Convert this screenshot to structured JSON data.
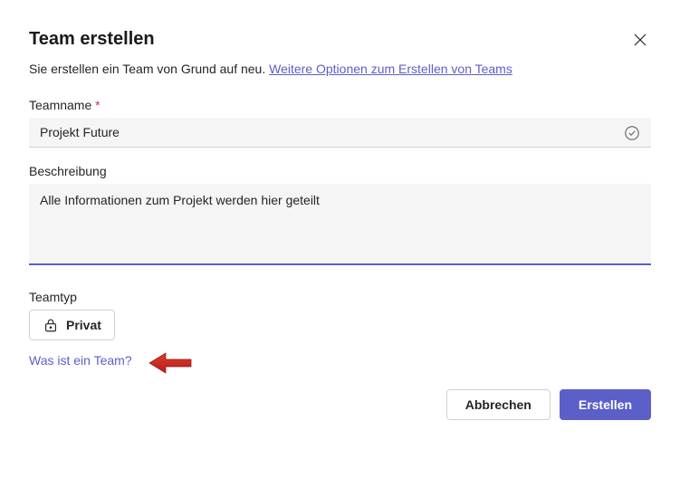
{
  "dialog": {
    "title": "Team erstellen",
    "subtitle_prefix": "Sie erstellen ein Team von Grund auf neu. ",
    "subtitle_link": "Weitere Optionen zum Erstellen von Teams"
  },
  "fields": {
    "teamname": {
      "label": "Teamname",
      "value": "Projekt Future"
    },
    "description": {
      "label": "Beschreibung",
      "value": "Alle Informationen zum Projekt werden hier geteilt"
    },
    "teamtype": {
      "label": "Teamtyp",
      "button_label": "Privat"
    }
  },
  "links": {
    "help": "Was ist ein Team?"
  },
  "buttons": {
    "cancel": "Abbrechen",
    "create": "Erstellen"
  }
}
